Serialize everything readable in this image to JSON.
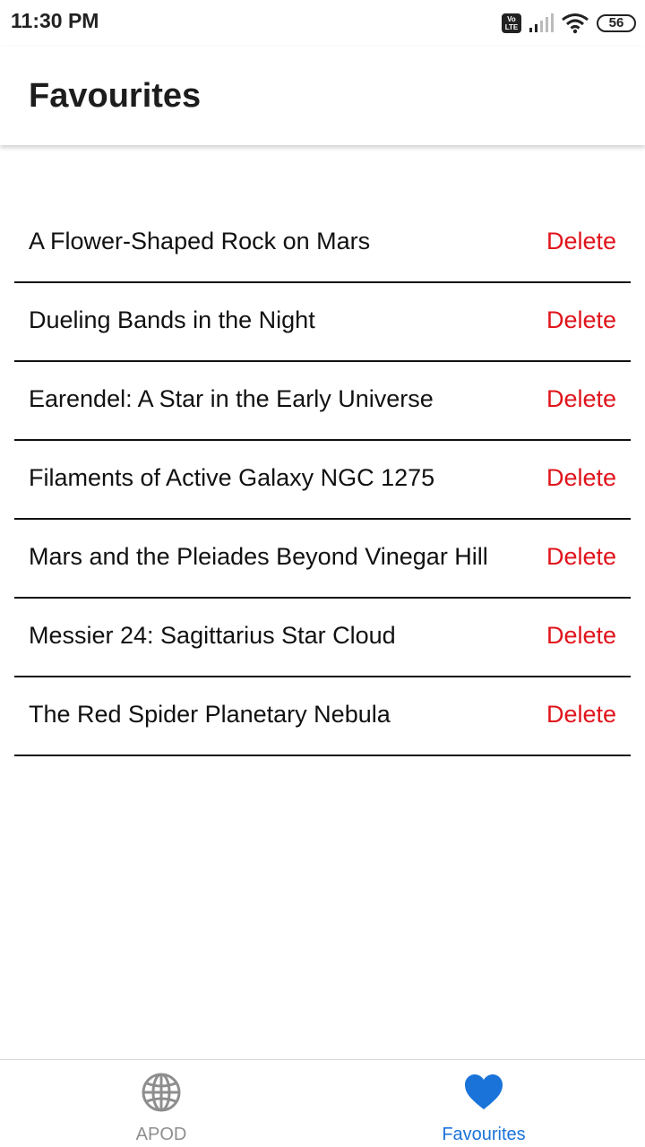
{
  "status_bar": {
    "time": "11:30 PM",
    "volte_top": "Vo",
    "volte_bottom": "LTE",
    "battery": "56"
  },
  "header": {
    "title": "Favourites"
  },
  "favourites": {
    "delete_label": "Delete",
    "items": [
      {
        "title": "A Flower-Shaped Rock on Mars"
      },
      {
        "title": "Dueling Bands in the Night"
      },
      {
        "title": "Earendel: A Star in the Early Universe"
      },
      {
        "title": "Filaments of Active Galaxy NGC 1275"
      },
      {
        "title": "Mars and the Pleiades Beyond Vinegar Hill"
      },
      {
        "title": "Messier 24: Sagittarius Star Cloud"
      },
      {
        "title": "The Red Spider Planetary Nebula"
      }
    ]
  },
  "bottom_nav": {
    "tabs": [
      {
        "label": "APOD",
        "icon": "globe-icon",
        "active": false
      },
      {
        "label": "Favourites",
        "icon": "heart-icon",
        "active": true
      }
    ]
  },
  "colors": {
    "delete": "#e0141b",
    "active_tab": "#1a73d9",
    "inactive_tab": "#8e8e8e"
  }
}
